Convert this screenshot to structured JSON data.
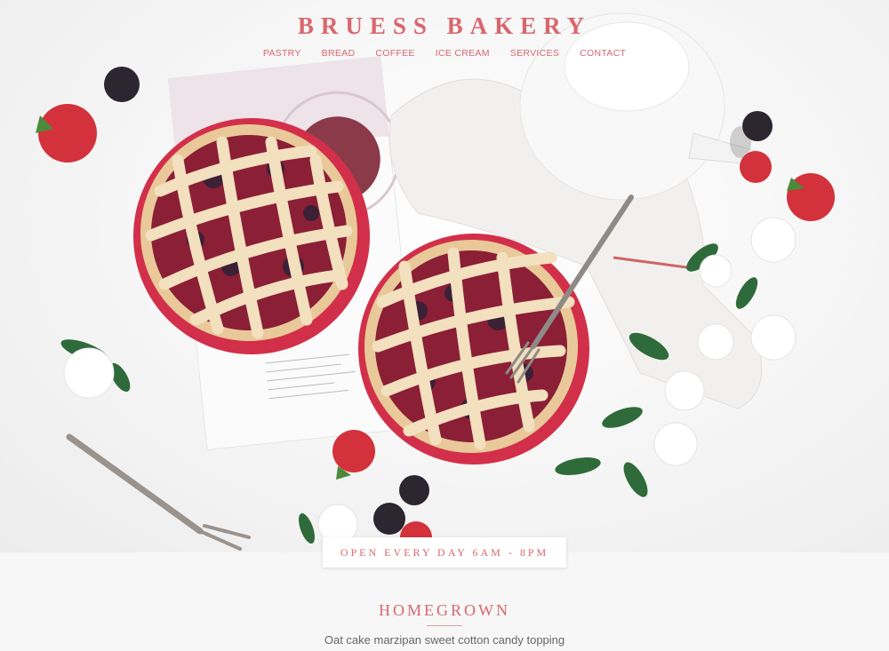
{
  "header": {
    "brand": "BRUESS BAKERY",
    "nav": [
      "PASTRY",
      "BREAD",
      "COFFEE",
      "ICE CREAM",
      "SERVICES",
      "CONTACT"
    ]
  },
  "hero": {
    "hours_badge": "OPEN EVERY DAY 6AM - 8PM"
  },
  "section": {
    "title": "HOMEGROWN",
    "text": "Oat cake marzipan sweet cotton candy topping"
  },
  "colors": {
    "accent": "#d9666f",
    "background": "#f7f7f7"
  }
}
